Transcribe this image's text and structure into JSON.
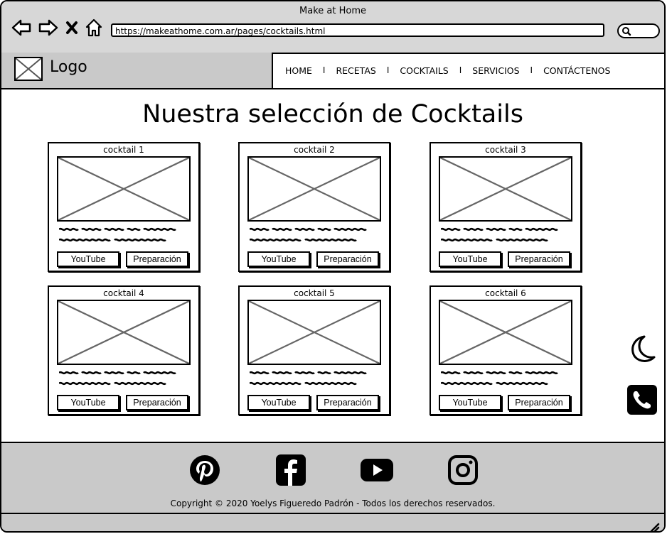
{
  "window": {
    "title": "Make at Home"
  },
  "browser": {
    "url": "https://makeathome.com.ar/pages/cocktails.html"
  },
  "header": {
    "logo_label": "Logo",
    "menu": [
      {
        "label": "HOME"
      },
      {
        "label": "RECETAS"
      },
      {
        "label": "COCKTAILS"
      },
      {
        "label": "SERVICIOS"
      },
      {
        "label": "CONTÁCTENOS"
      }
    ],
    "separator": "I"
  },
  "main": {
    "title": "Nuestra selección de Cocktails",
    "cards": [
      {
        "title": "cocktail 1",
        "youtube": "YouTube",
        "prep": "Preparación"
      },
      {
        "title": "cocktail 2",
        "youtube": "YouTube",
        "prep": "Preparación"
      },
      {
        "title": "cocktail 3",
        "youtube": "YouTube",
        "prep": "Preparación"
      },
      {
        "title": "cocktail 4",
        "youtube": "YouTube",
        "prep": "Preparación"
      },
      {
        "title": "cocktail 5",
        "youtube": "YouTube",
        "prep": "Preparación"
      },
      {
        "title": "cocktail 6",
        "youtube": "YouTube",
        "prep": "Preparación"
      }
    ]
  },
  "side": {
    "icons": [
      "moon-icon",
      "phone-icon"
    ]
  },
  "footer": {
    "social": [
      "pinterest-icon",
      "facebook-icon",
      "youtube-icon",
      "instagram-icon"
    ],
    "copyright": "Copyright © 2020 Yoelys Figueredo Padrón - Todos los derechos reservados."
  }
}
